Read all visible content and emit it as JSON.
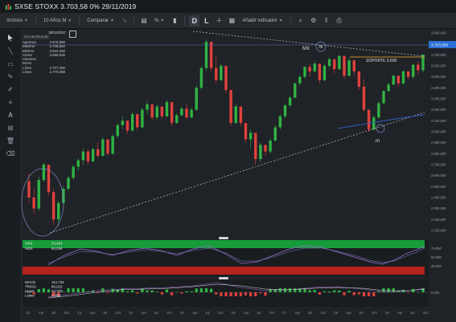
{
  "window": {
    "title": "SXSE STOXX  3.703,58  0%  29/11/2019"
  },
  "toolbar": {
    "archive_label": "Archivo",
    "range_label": "10 Años M",
    "compare_label": "Comparar",
    "indicator_label": "Añadir indicador",
    "daily_label": "D",
    "log_label": "L",
    "pct_label": "%",
    "fx_label": "⁺ₓ"
  },
  "ohlc": {
    "date": "30/11/2017",
    "instrument": "STX 50 PR EUR",
    "rows": [
      {
        "k": "Apertura",
        "v": "3.676,990"
      },
      {
        "k": "Máximo",
        "v": "3.708,820"
      },
      {
        "k": "Mínimo",
        "v": "3.519,350"
      },
      {
        "k": "Cierre",
        "v": "3.569,930"
      },
      {
        "k": "Volumen",
        "v": "-"
      },
      {
        "k": "MovS",
        "v": "-"
      },
      {
        "k": "Línea",
        "v": "3.707,256"
      },
      {
        "k": "Línea",
        "v": "2.770,388"
      }
    ]
  },
  "price_axis": {
    "labels": [
      "3.900,000",
      "3.800,000",
      "3.700,000",
      "3.600,000",
      "3.500,000",
      "3.400,000",
      "3.300,000",
      "3.200,000",
      "3.100,000",
      "3.000,000",
      "2.900,000",
      "2.800,000",
      "2.700,000",
      "2.600,000",
      "2.500,000",
      "2.400,000",
      "2.300,000",
      "2.200,000",
      "2.100,000"
    ],
    "current_price_tag": "3.703,580"
  },
  "annotations": {
    "support_label": "SOPORTE 3.600",
    "mx_label": "MX",
    "mx2_label": "35",
    "min_label": "m"
  },
  "stoch": {
    "k_label": "%K5",
    "k_value": "83,494",
    "d_label": "%D5",
    "d_value": "84,048",
    "axis_labels": [
      "75,000",
      "50,000",
      "25,000"
    ]
  },
  "macd": {
    "rows": [
      {
        "k": "MACD",
        "v": "114,733"
      },
      {
        "k": "TRIGG",
        "v": "80,023"
      },
      {
        "k": "Upper",
        "v": "34,700"
      },
      {
        "k": "Lower",
        "v": "0,000"
      }
    ],
    "axis_label": "0,000"
  },
  "time_axis": {
    "labels": [
      "'12",
      "Apr",
      "Jul",
      "Oct",
      "'13",
      "Apr",
      "Jul",
      "Oct",
      "'14",
      "Apr",
      "Jul",
      "Oct",
      "'15",
      "Apr",
      "Jul",
      "Oct",
      "'16",
      "Apr",
      "Jul",
      "Oct",
      "'17",
      "Apr",
      "Jul",
      "Oct",
      "'18",
      "Apr",
      "Jul",
      "Oct",
      "'19",
      "Apr",
      "Jul",
      "Oct"
    ]
  },
  "chart_data": {
    "type": "candlestick",
    "instrument": "STX 50 PR EUR",
    "period": "10 Años M",
    "ylim": [
      2100,
      3900
    ],
    "candles": [
      [
        2550,
        2620,
        2350,
        2400
      ],
      [
        2400,
        2480,
        2250,
        2300
      ],
      [
        2300,
        2590,
        2280,
        2560
      ],
      [
        2560,
        2720,
        2540,
        2700
      ],
      [
        2700,
        2680,
        2420,
        2450
      ],
      [
        2450,
        2480,
        2150,
        2200
      ],
      [
        2200,
        2370,
        2140,
        2350
      ],
      [
        2350,
        2500,
        2320,
        2480
      ],
      [
        2480,
        2600,
        2460,
        2580
      ],
      [
        2580,
        2700,
        2560,
        2680
      ],
      [
        2680,
        2760,
        2640,
        2740
      ],
      [
        2740,
        2850,
        2700,
        2820
      ],
      [
        2820,
        2840,
        2700,
        2730
      ],
      [
        2730,
        2860,
        2720,
        2840
      ],
      [
        2840,
        2900,
        2760,
        2780
      ],
      [
        2780,
        2950,
        2770,
        2930
      ],
      [
        2930,
        2880,
        2780,
        2800
      ],
      [
        2800,
        2980,
        2790,
        2960
      ],
      [
        2960,
        3080,
        2940,
        3060
      ],
      [
        3060,
        3140,
        3020,
        3100
      ],
      [
        3100,
        3070,
        2980,
        3010
      ],
      [
        3010,
        3180,
        3000,
        3160
      ],
      [
        3160,
        3120,
        3020,
        3040
      ],
      [
        3040,
        3220,
        3030,
        3200
      ],
      [
        3200,
        3280,
        3160,
        3250
      ],
      [
        3250,
        3150,
        3100,
        3130
      ],
      [
        3130,
        3250,
        3110,
        3230
      ],
      [
        3230,
        3200,
        3120,
        3140
      ],
      [
        3140,
        3290,
        3130,
        3270
      ],
      [
        3270,
        3170,
        3050,
        3080
      ],
      [
        3080,
        3170,
        3070,
        3150
      ],
      [
        3150,
        3230,
        3140,
        3210
      ],
      [
        3210,
        3260,
        3110,
        3130
      ],
      [
        3130,
        3220,
        3120,
        3200
      ],
      [
        3200,
        3420,
        3190,
        3400
      ],
      [
        3400,
        3600,
        3380,
        3580
      ],
      [
        3580,
        3840,
        3560,
        3820
      ],
      [
        3820,
        3720,
        3550,
        3580
      ],
      [
        3580,
        3700,
        3440,
        3470
      ],
      [
        3470,
        3620,
        3460,
        3600
      ],
      [
        3600,
        3450,
        3350,
        3380
      ],
      [
        3380,
        3300,
        3050,
        3080
      ],
      [
        3080,
        3250,
        3070,
        3230
      ],
      [
        3230,
        3200,
        3050,
        3080
      ],
      [
        3080,
        3060,
        2900,
        2930
      ],
      [
        2930,
        3020,
        2850,
        2990
      ],
      [
        2990,
        2950,
        2700,
        2750
      ],
      [
        2750,
        2900,
        2720,
        2880
      ],
      [
        2880,
        2870,
        2780,
        2820
      ],
      [
        2820,
        2940,
        2800,
        2920
      ],
      [
        2920,
        3060,
        2910,
        3040
      ],
      [
        3040,
        3160,
        3020,
        3140
      ],
      [
        3140,
        3260,
        3120,
        3240
      ],
      [
        3240,
        3330,
        3220,
        3310
      ],
      [
        3310,
        3450,
        3300,
        3440
      ],
      [
        3440,
        3520,
        3420,
        3500
      ],
      [
        3500,
        3600,
        3480,
        3590
      ],
      [
        3590,
        3620,
        3500,
        3550
      ],
      [
        3550,
        3640,
        3540,
        3620
      ],
      [
        3620,
        3560,
        3440,
        3470
      ],
      [
        3470,
        3620,
        3460,
        3600
      ],
      [
        3600,
        3680,
        3580,
        3660
      ],
      [
        3660,
        3600,
        3530,
        3570
      ],
      [
        3570,
        3700,
        3560,
        3690
      ],
      [
        3690,
        3580,
        3480,
        3510
      ],
      [
        3510,
        3670,
        3500,
        3650
      ],
      [
        3650,
        3620,
        3520,
        3550
      ],
      [
        3550,
        3480,
        3380,
        3410
      ],
      [
        3410,
        3480,
        3180,
        3200
      ],
      [
        3200,
        3140,
        3000,
        3020
      ],
      [
        3020,
        3150,
        3010,
        3130
      ],
      [
        3130,
        3280,
        3120,
        3260
      ],
      [
        3260,
        3380,
        3250,
        3370
      ],
      [
        3370,
        3450,
        3360,
        3430
      ],
      [
        3430,
        3520,
        3420,
        3510
      ],
      [
        3510,
        3480,
        3410,
        3440
      ],
      [
        3440,
        3560,
        3430,
        3550
      ],
      [
        3550,
        3530,
        3470,
        3500
      ],
      [
        3500,
        3620,
        3480,
        3610
      ],
      [
        3610,
        3640,
        3520,
        3560
      ],
      [
        3560,
        3700,
        3540,
        3703
      ]
    ]
  }
}
